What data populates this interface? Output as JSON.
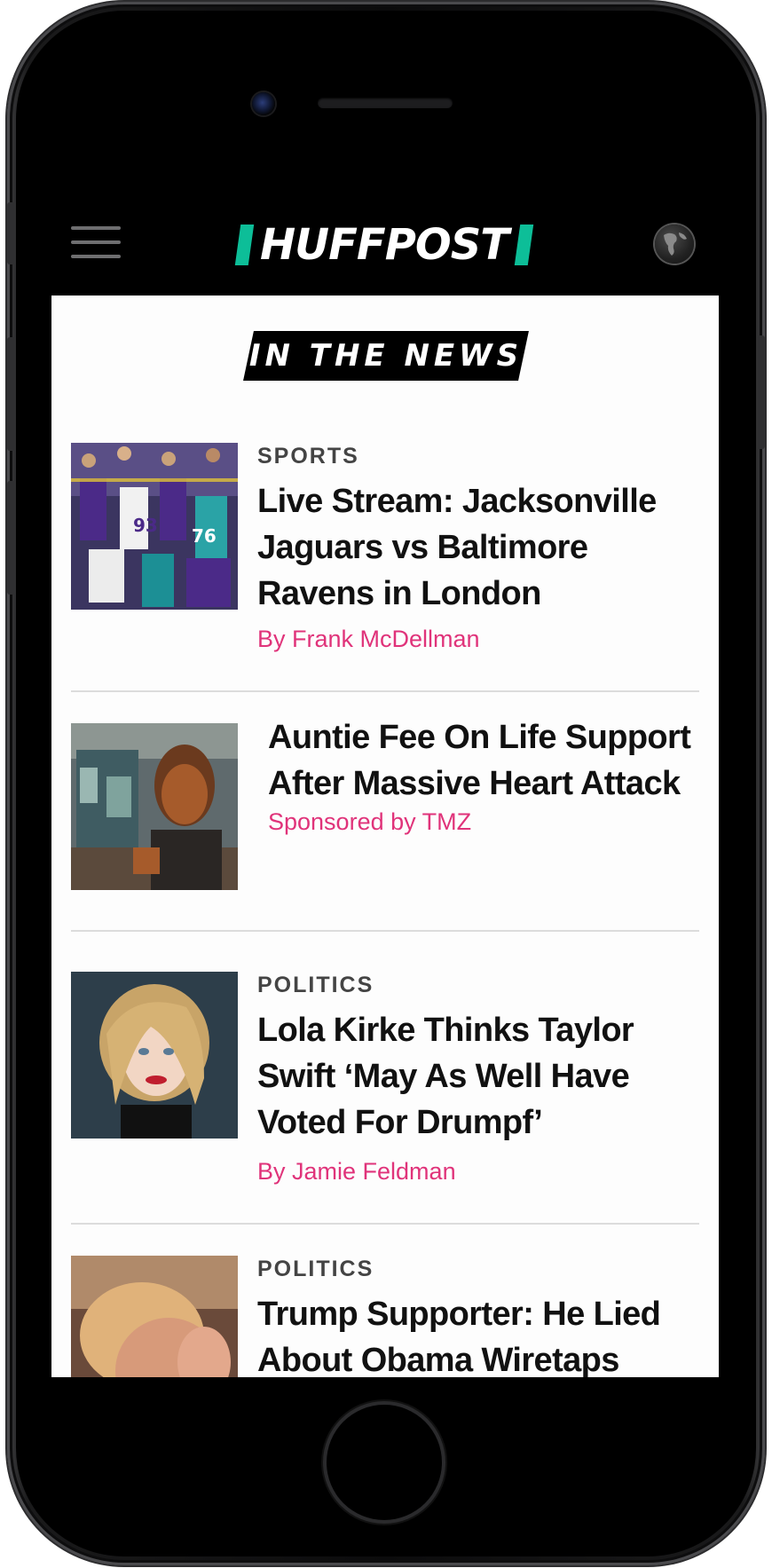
{
  "header": {
    "logo_text": "HUFFPOST",
    "menu_icon": "hamburger-menu-icon",
    "region_icon": "globe-icon",
    "brand_color": "#0dbe98"
  },
  "section_banner": "IN THE NEWS",
  "articles": [
    {
      "category": "SPORTS",
      "headline": "Live Stream: Jacksonville Jaguars vs Baltimore Ravens in London",
      "byline": "By Frank McDellman",
      "thumbnail": "football-players-photo"
    },
    {
      "category": "",
      "headline": "Auntie Fee On Life Support After Massive Heart Attack",
      "byline": "Sponsored by TMZ",
      "thumbnail": "woman-kitchen-photo"
    },
    {
      "category": "POLITICS",
      "headline": "Lola Kirke Thinks Taylor Swift ‘May As Well Have Voted For Drumpf’",
      "byline": "By Jamie Feldman",
      "thumbnail": "blonde-woman-portrait-photo"
    },
    {
      "category": "POLITICS",
      "headline": "Trump Supporter: He Lied About Obama Wiretaps",
      "byline": "",
      "thumbnail": "man-hand-on-face-photo"
    }
  ],
  "colors": {
    "byline": "#e0337a",
    "navbar": "#000000"
  }
}
